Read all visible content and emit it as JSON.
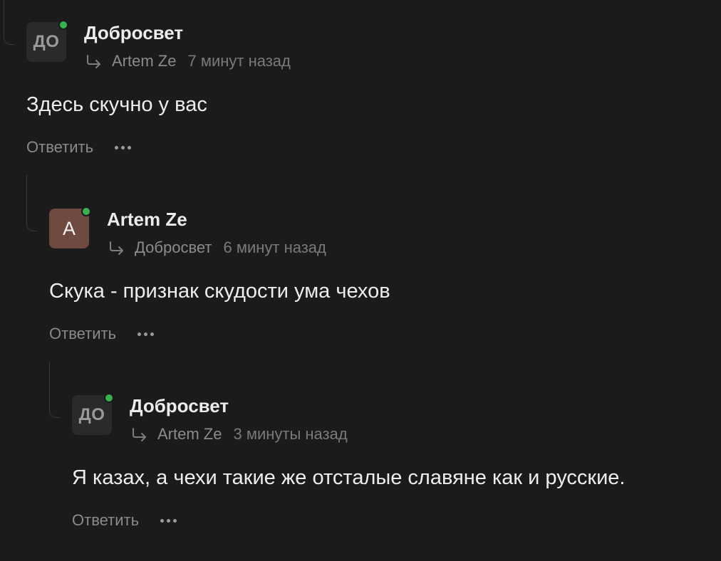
{
  "comments": [
    {
      "author": "Добросвет",
      "avatar_text": "ДО",
      "reply_to": "Artem Ze",
      "time": "7 минут назад",
      "text": "Здесь скучно у вас",
      "reply_label": "Ответить"
    },
    {
      "author": "Artem Ze",
      "avatar_text": "A",
      "reply_to": "Добросвет",
      "time": "6 минут назад",
      "text": "Скука - признак скудости ума чехов",
      "reply_label": "Ответить"
    },
    {
      "author": "Добросвет",
      "avatar_text": "ДО",
      "reply_to": "Artem Ze",
      "time": "3 минуты назад",
      "text": "Я казах, а чехи такие же отсталые славяне как и русские.",
      "reply_label": "Ответить"
    }
  ],
  "icons": {
    "reply_arrow": "reply-arrow-icon",
    "more": "more-dots-icon",
    "online": "online-status-dot"
  },
  "colors": {
    "background": "#1b1b1b",
    "online": "#37b24d",
    "avatar_letter_bg": "#6e4a40",
    "avatar_initials_bg": "#2a2a2a"
  }
}
